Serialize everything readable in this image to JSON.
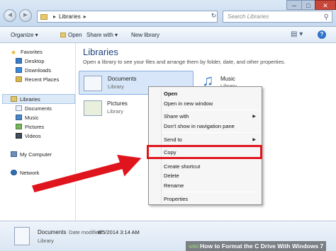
{
  "titlebar": {
    "breadcrumb": [
      "Libraries"
    ],
    "search_placeholder": "Search Libraries",
    "back_glyph": "◄",
    "forward_glyph": "►",
    "minimize_glyph": "─",
    "maximize_glyph": "□",
    "close_glyph": "✕"
  },
  "toolbar": {
    "organize": "Organize ▾",
    "open": "Open",
    "share_with": "Share with ▾",
    "new_library": "New library"
  },
  "sidebar": {
    "favorites": "Favorites",
    "desktop": "Desktop",
    "downloads": "Downloads",
    "recent_places": "Recent Places",
    "libraries": "Libraries",
    "documents": "Documents",
    "music": "Music",
    "pictures": "Pictures",
    "videos": "Videos",
    "my_computer": "My Computer",
    "network": "Network"
  },
  "main": {
    "title": "Libraries",
    "subtitle": "Open a library to see your files and arrange them by folder, date, and other properties.",
    "libraries": [
      {
        "name": "Documents",
        "type": "Library"
      },
      {
        "name": "Music",
        "type": "Library"
      },
      {
        "name": "Pictures",
        "type": "Library"
      }
    ]
  },
  "context_menu": {
    "items": [
      "Open",
      "Open in new window",
      "Share with",
      "Don't show in navigation pane",
      "Send to",
      "Copy",
      "Create shortcut",
      "Delete",
      "Rename",
      "Properties"
    ],
    "highlighted": "Copy",
    "highlight_color": "#e0141c"
  },
  "details": {
    "name": "Documents",
    "modified_label": "Date modified:",
    "modified_value": "8/5/2014 3:14 AM",
    "type": "Library"
  },
  "watermark": {
    "brand": "wiki",
    "text": "How to Format the C Drive With Windows 7"
  },
  "icons": [
    "back-icon",
    "forward-icon",
    "folder-icon",
    "refresh-icon",
    "search-icon",
    "views-icon",
    "help-icon",
    "star-icon",
    "desktop-icon",
    "downloads-icon",
    "recent-places-icon",
    "library-icon",
    "documents-icon",
    "music-icon",
    "pictures-icon",
    "videos-icon",
    "computer-icon",
    "network-icon"
  ]
}
